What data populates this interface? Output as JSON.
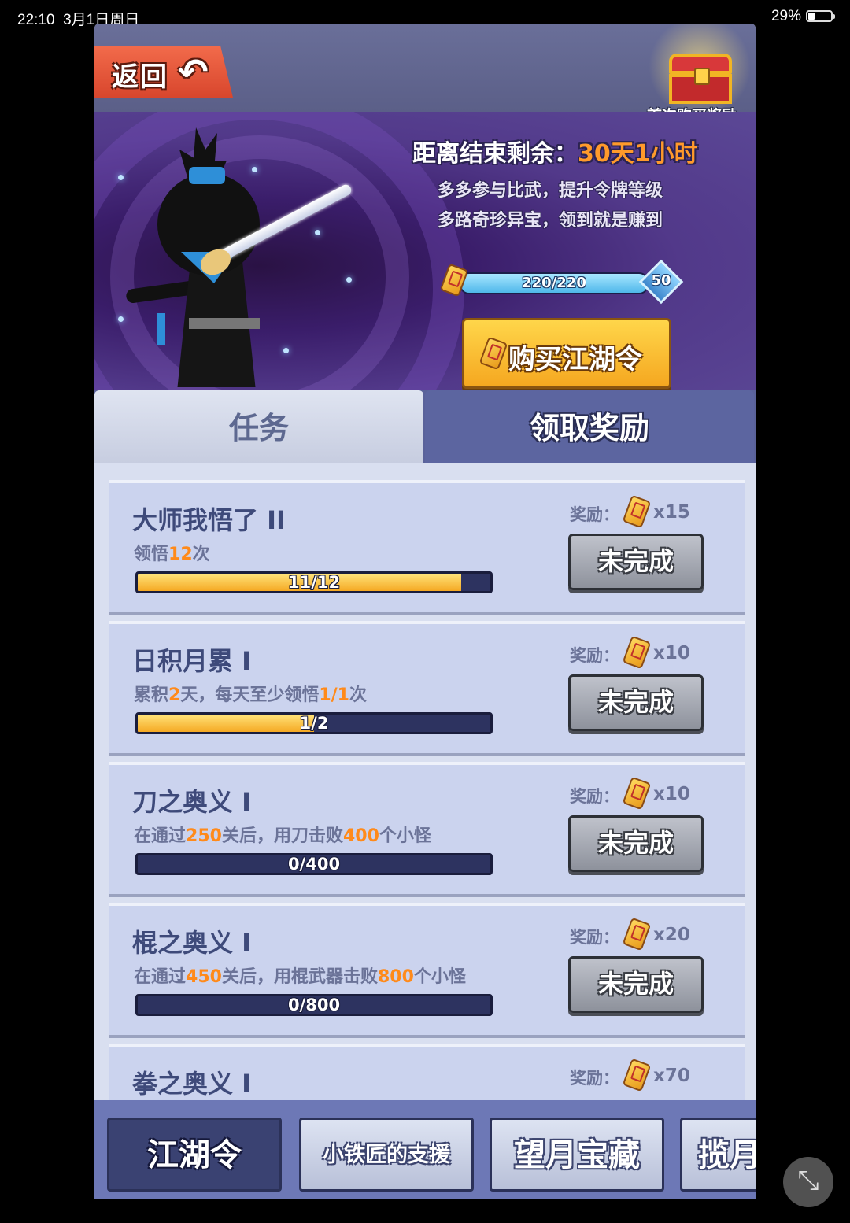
{
  "status_bar": {
    "time": "22:10",
    "date": "3月1日周日",
    "battery_pct": "29%"
  },
  "header": {
    "back_label": "返回",
    "back_icon": "undo-arrow-icon",
    "chest_label": "首次购买奖励"
  },
  "banner": {
    "countdown_label": "距离结束剩余：",
    "countdown_value": "30天1小时",
    "tagline_1": "多多参与比武，提升令牌等级",
    "tagline_2": "多路奇珍异宝，领到就是赚到",
    "level_progress_text": "220/220",
    "level_progress_fraction": 1.0,
    "level_number": "50",
    "buy_button_label": "购买江湖令"
  },
  "tabs": [
    {
      "label": "任务",
      "active": true
    },
    {
      "label": "领取奖励",
      "active": false
    }
  ],
  "tasks": [
    {
      "title": "大师我悟了 II",
      "desc_parts": [
        "领悟",
        "12",
        "次"
      ],
      "progress_text": "11/12",
      "progress_fraction": 0.9167,
      "reward_label": "奖励：",
      "reward_count": "x15",
      "status_label": "未完成"
    },
    {
      "title": "日积月累 I",
      "desc_parts": [
        "累积",
        "2",
        "天，每天至少领悟",
        "1/1",
        "次"
      ],
      "progress_text": "1/2",
      "progress_fraction": 0.5,
      "reward_label": "奖励：",
      "reward_count": "x10",
      "status_label": "未完成"
    },
    {
      "title": "刀之奥义 I",
      "desc_parts": [
        "在通过",
        "250",
        "关后，用刀击败",
        "400",
        "个小怪"
      ],
      "progress_text": "0/400",
      "progress_fraction": 0,
      "reward_label": "奖励：",
      "reward_count": "x10",
      "status_label": "未完成"
    },
    {
      "title": "棍之奥义 I",
      "desc_parts": [
        "在通过",
        "450",
        "关后，用棍武器击败",
        "800",
        "个小怪"
      ],
      "progress_text": "0/800",
      "progress_fraction": 0,
      "reward_label": "奖励：",
      "reward_count": "x20",
      "status_label": "未完成"
    },
    {
      "title": "拳之奥义 I",
      "desc_parts": [],
      "progress_text": "",
      "progress_fraction": 0,
      "reward_label": "奖励：",
      "reward_count": "x70",
      "status_label": ""
    }
  ],
  "bottom_nav": [
    {
      "label": "江湖令",
      "active": true
    },
    {
      "label": "小铁匠的支援",
      "active": false
    },
    {
      "label": "望月宝藏",
      "active": false
    },
    {
      "label": "揽月",
      "active": false
    }
  ],
  "icons": {
    "reward": "token-icon",
    "chest": "treasure-chest-icon",
    "float": "collapse-icon"
  },
  "colors": {
    "highlight": "#ff8a1a",
    "countdown": "#ff9a2b",
    "progress_fill": "#f5a923"
  }
}
